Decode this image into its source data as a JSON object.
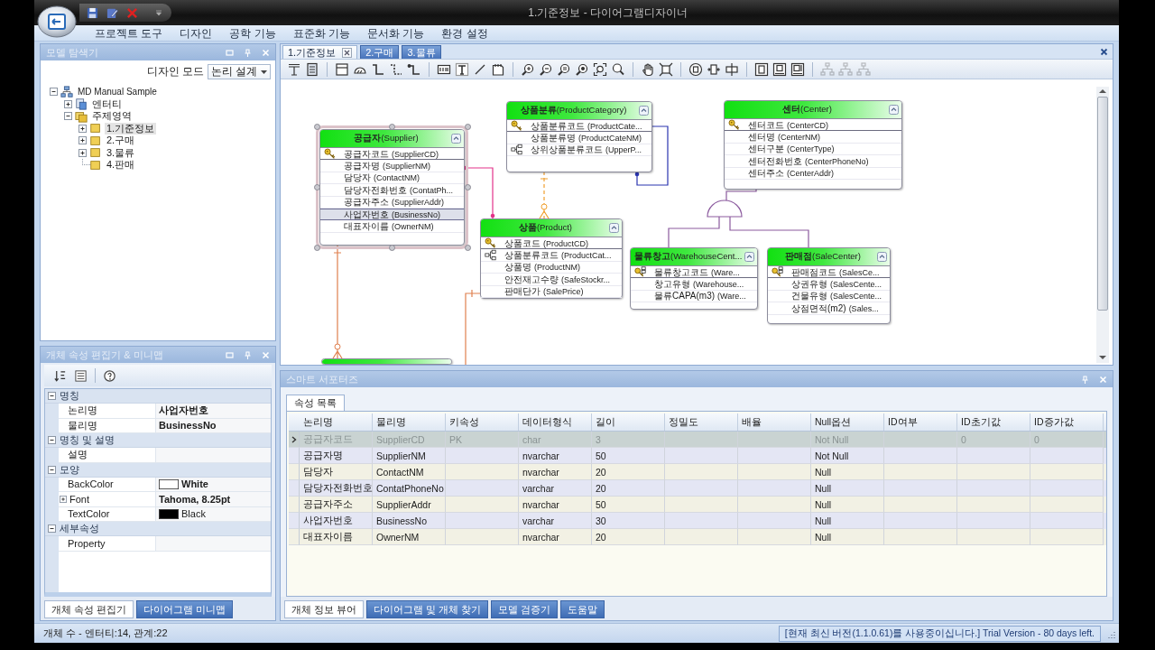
{
  "window": {
    "title": "1.기준정보 - 다이어그램디자이너",
    "menu": [
      "프로젝트 도구",
      "디자인",
      "공학 기능",
      "표준화 기능",
      "문서화 기능",
      "환경 설정"
    ]
  },
  "model_explorer": {
    "title": "모델 탐색기",
    "design_mode": {
      "label": "디자인 모드",
      "value": "논리 설계"
    },
    "tree": [
      {
        "label": "MD Manual Sample",
        "expanded": true,
        "selected": false,
        "children": [
          {
            "label": "엔터티",
            "expanded": false,
            "selected": false
          },
          {
            "label": "주제영역",
            "expanded": true,
            "selected": false,
            "children": [
              {
                "label": "1.기준정보",
                "expanded": false,
                "selected": true
              },
              {
                "label": "2.구매",
                "expanded": false,
                "selected": false
              },
              {
                "label": "3.물류",
                "expanded": false,
                "selected": false
              },
              {
                "label": "4.판매",
                "selected": false
              }
            ]
          }
        ]
      }
    ]
  },
  "property_editor": {
    "title": "개체 속성 편집기 & 미니맵",
    "groups": [
      {
        "name": "명칭",
        "expanded": true,
        "rows": [
          {
            "name": "논리명",
            "value": "사업자번호",
            "modified": true
          },
          {
            "name": "물리명",
            "value": "BusinessNo",
            "modified": true
          }
        ]
      },
      {
        "name": "명칭 및 설명",
        "expanded": true,
        "rows": [
          {
            "name": "설명"
          }
        ]
      },
      {
        "name": "모양",
        "expanded": true,
        "rows": [
          {
            "name": "BackColor",
            "value": "White",
            "modified": true,
            "color": "#ffffff"
          },
          {
            "name": "Font",
            "value": "Tahoma, 8.25pt",
            "modified": true,
            "expanded": false
          },
          {
            "name": "TextColor",
            "value": "Black",
            "modified": false,
            "color": "#000000"
          }
        ]
      },
      {
        "name": "세부속성",
        "expanded": true,
        "rows": [
          {
            "name": "Property"
          }
        ]
      }
    ],
    "tabs": [
      {
        "label": "개체 속성 편집기",
        "selected": true
      },
      {
        "label": "다이어그램 미니맵",
        "selected": false
      }
    ]
  },
  "document_tabs": [
    {
      "label": "1.기준정보",
      "selected": true
    },
    {
      "label": "2.구매",
      "selected": false
    },
    {
      "label": "3.물류",
      "selected": false
    }
  ],
  "toolbar": [
    {
      "disabled": false
    },
    {
      "disabled": false
    },
    {
      "disabled": false
    },
    {
      "disabled": false
    },
    {
      "disabled": false
    },
    {
      "disabled": false
    },
    {
      "disabled": false
    },
    {
      "disabled": false
    },
    {
      "disabled": false
    },
    {
      "disabled": false
    },
    {
      "disabled": false
    },
    {
      "disabled": false
    },
    {
      "disabled": false
    },
    {
      "disabled": false
    },
    {
      "disabled": false
    },
    {
      "disabled": false
    },
    {
      "disabled": false
    },
    {
      "disabled": false
    },
    {
      "disabled": false
    },
    {
      "disabled": false
    },
    {
      "disabled": false
    },
    {
      "disabled": false
    },
    {
      "disabled": false
    },
    {
      "disabled": false
    },
    {
      "disabled": false
    },
    {
      "disabled": true
    },
    {
      "disabled": true
    },
    {
      "disabled": true
    }
  ],
  "diagram": {
    "entities": [
      {
        "title": "**공급자**(Supplier)",
        "selected": true,
        "attributes": [
          {
            "name": "공급자코드",
            "physical": "(SupplierCD)",
            "kind": "pk",
            "selected": false
          },
          {
            "name": "공급자명",
            "physical": "(SupplierNM)",
            "kind": "attribute",
            "selected": false
          },
          {
            "name": "담당자",
            "physical": "(ContactNM)",
            "kind": "attribute",
            "selected": false
          },
          {
            "name": "담당자전화번호",
            "physical": "(ContatPh...",
            "kind": "attribute",
            "selected": false
          },
          {
            "name": "공급자주소",
            "physical": "(SupplierAddr)",
            "kind": "attribute",
            "selected": false
          },
          {
            "name": "사업자번호",
            "physical": "(BusinessNo)",
            "kind": "attribute",
            "selected": true
          },
          {
            "name": "대표자이름",
            "physical": "(OwnerNM)",
            "kind": "attribute",
            "selected": false
          }
        ]
      },
      {
        "title": "**상품분류**(ProductCategory)",
        "selected": false,
        "attributes": [
          {
            "name": "상품분류코드",
            "physical": "(ProductCate...",
            "kind": "pk",
            "selected": false
          },
          {
            "name": "상품분류명",
            "physical": "(ProductCateNM)",
            "kind": "attribute",
            "selected": false
          },
          {
            "name": "상위상품분류코드",
            "physical": "(UpperP...",
            "kind": "fk",
            "selected": false
          }
        ]
      },
      {
        "title": "**상품**(Product)",
        "selected": false,
        "attributes": [
          {
            "name": "상품코드",
            "physical": "(ProductCD)",
            "kind": "pk",
            "selected": false
          },
          {
            "name": "상품분류코드",
            "physical": "(ProductCat...",
            "kind": "fk",
            "selected": false
          },
          {
            "name": "상품명",
            "physical": "(ProductNM)",
            "kind": "attribute",
            "selected": false
          },
          {
            "name": "안전재고수량",
            "physical": "(SafeStockr...",
            "kind": "attribute",
            "selected": false
          },
          {
            "name": "판매단가",
            "physical": "(SalePrice)",
            "kind": "attribute",
            "selected": false
          }
        ]
      },
      {
        "title": "**센터**(Center)",
        "selected": false,
        "attributes": [
          {
            "name": "센터코드",
            "physical": "(CenterCD)",
            "kind": "pk",
            "selected": false
          },
          {
            "name": "센터명",
            "physical": "(CenterNM)",
            "kind": "attribute",
            "selected": false
          },
          {
            "name": "센터구분",
            "physical": "(CenterType)",
            "kind": "attribute",
            "selected": false
          },
          {
            "name": "센터전화번호",
            "physical": "(CenterPhoneNo)",
            "kind": "attribute",
            "selected": false
          },
          {
            "name": "센터주소",
            "physical": "(CenterAddr)",
            "kind": "attribute",
            "selected": false
          }
        ]
      },
      {
        "title": "**물류창고**(WarehouseCent...",
        "selected": false,
        "attributes": [
          {
            "name": "물류창고코드",
            "physical": "(Ware...",
            "kind": "pk_fk",
            "selected": false
          },
          {
            "name": "창고유형",
            "physical": "(Warehouse...",
            "kind": "attribute",
            "selected": false
          },
          {
            "name": "물류CAPA(m3)",
            "physical": "(Ware...",
            "kind": "attribute",
            "selected": false
          }
        ]
      },
      {
        "title": "**판매점**(SaleCenter)",
        "selected": false,
        "attributes": [
          {
            "name": "판매점코드",
            "physical": "(SalesCe...",
            "kind": "pk_fk",
            "selected": false
          },
          {
            "name": "상권유형",
            "physical": "(SalesCente...",
            "kind": "attribute",
            "selected": false
          },
          {
            "name": "건물유형",
            "physical": "(SalesCente...",
            "kind": "attribute",
            "selected": false
          },
          {
            "name": "상점면적(m2)",
            "physical": "(Sales...",
            "kind": "attribute",
            "selected": false
          }
        ]
      },
      {
        "selected": false
      }
    ]
  },
  "smart_supporter": {
    "title": "스마트 서포터즈",
    "tabs": [
      {
        "label": "속성 목록",
        "selected": true
      }
    ],
    "columns": [
      "논리명",
      "물리명",
      "키속성",
      "데이터형식",
      "길이",
      "정밀도",
      "배율",
      "Null옵션",
      "ID여부",
      "ID초기값",
      "ID증가값"
    ],
    "rows": [
      {
        "selected": true,
        "cells": [
          "공급자코드",
          "SupplierCD",
          "PK",
          "char",
          "3",
          null,
          null,
          "Not Null",
          null,
          "0",
          "0"
        ]
      },
      {
        "selected": false,
        "cells": [
          "공급자명",
          "SupplierNM",
          null,
          "nvarchar",
          "50",
          null,
          null,
          "Not Null",
          null,
          null,
          null
        ]
      },
      {
        "selected": false,
        "cells": [
          "담당자",
          "ContactNM",
          null,
          "nvarchar",
          "20",
          null,
          null,
          "Null",
          null,
          null,
          null
        ]
      },
      {
        "selected": false,
        "cells": [
          "담당자전화번호",
          "ContatPhoneNo",
          null,
          "varchar",
          "20",
          null,
          null,
          "Null",
          null,
          null,
          null
        ]
      },
      {
        "selected": false,
        "cells": [
          "공급자주소",
          "SupplierAddr",
          null,
          "nvarchar",
          "50",
          null,
          null,
          "Null",
          null,
          null,
          null
        ]
      },
      {
        "selected": false,
        "cells": [
          "사업자번호",
          "BusinessNo",
          null,
          "varchar",
          "30",
          null,
          null,
          "Null",
          null,
          null,
          null
        ]
      },
      {
        "selected": false,
        "cells": [
          "대표자이름",
          "OwnerNM",
          null,
          "nvarchar",
          "20",
          null,
          null,
          "Null",
          null,
          null,
          null
        ]
      }
    ],
    "bottom_tabs": [
      {
        "label": "개체 정보 뷰어",
        "selected": true
      },
      {
        "label": "다이어그램 및 개체 찾기",
        "selected": false
      },
      {
        "label": "모델 검증기",
        "selected": false
      },
      {
        "label": "도움말",
        "selected": false
      }
    ]
  },
  "status_bar": {
    "counts": "개체 수 - 엔터티:14, 관계:22",
    "version_notice": "[현재 최신 버전(1.1.0.61)를 사용중이십니다.] Trial Version - 80 days left."
  }
}
